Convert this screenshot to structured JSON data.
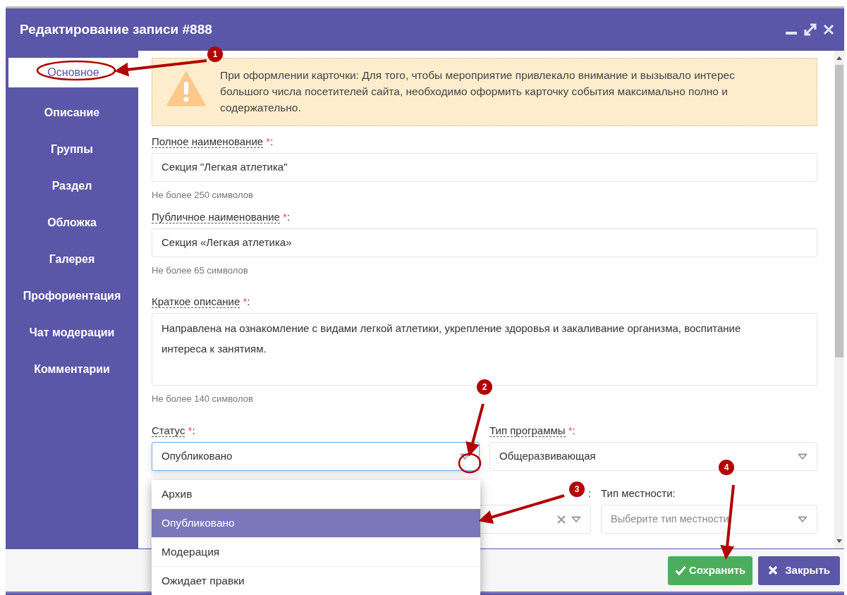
{
  "window": {
    "title": "Редактирование записи #888"
  },
  "sidebar": {
    "items": [
      {
        "label": "Основное",
        "selected": true
      },
      {
        "label": "Описание",
        "selected": false
      },
      {
        "label": "Группы",
        "selected": false
      },
      {
        "label": "Раздел",
        "selected": false
      },
      {
        "label": "Обложка",
        "selected": false
      },
      {
        "label": "Галерея",
        "selected": false
      },
      {
        "label": "Профориентация",
        "selected": false
      },
      {
        "label": "Чат модерации",
        "selected": false
      },
      {
        "label": "Комментарии",
        "selected": false
      }
    ]
  },
  "alert": {
    "text": "При оформлении карточки: Для того, чтобы мероприятие привлекало внимание и вызывало интерес большого числа посетителей сайта, необходимо оформить карточку события максимально полно и содержательно."
  },
  "fields": [
    {
      "kind": "input",
      "label": "Полное наименование",
      "required_mark": "*",
      "colon": ":",
      "value": "Секция \"Легкая атлетика\"",
      "hint": "Не более 250 символов"
    },
    {
      "kind": "input",
      "label": "Публичное наименование",
      "required_mark": "*",
      "colon": ":",
      "value": "Секция «Легкая атлетика»",
      "hint": "Не более 65 символов"
    },
    {
      "kind": "textarea",
      "label": "Краткое описание",
      "required_mark": "*",
      "colon": ":",
      "value": "Направлена на ознакомление с видами легкой атлетики, укрепление здоровья и закаливание организма, воспитание интереса к занятиям.",
      "hint": "Не более 140 символов"
    }
  ],
  "select_rows": [
    [
      {
        "label": "Статус",
        "required_mark": "*",
        "colon": ":",
        "value": "Опубликовано",
        "expanded": true,
        "clearable": false,
        "options": [
          {
            "label": "Архив",
            "selected": false
          },
          {
            "label": "Опубликовано",
            "selected": true
          },
          {
            "label": "Модерация",
            "selected": false
          },
          {
            "label": "Ожидает правки",
            "selected": false
          }
        ]
      },
      {
        "label": "Тип программы",
        "required_mark": "*",
        "colon": ":",
        "value": "Общеразвивающая",
        "expanded": false,
        "clearable": false
      }
    ],
    [
      {
        "colon": ":",
        "expanded": false,
        "clearable": true
      },
      {
        "label": "Тип местности:",
        "placeholder": "Выберите тип местности",
        "expanded": false,
        "clearable": false
      }
    ]
  ],
  "buttons": [
    {
      "kind": "save",
      "label": "Сохранить"
    },
    {
      "kind": "close",
      "label": "Закрыть"
    }
  ],
  "annotations": [
    {
      "number": "1"
    },
    {
      "number": "2"
    },
    {
      "number": "3"
    },
    {
      "number": "4"
    }
  ]
}
